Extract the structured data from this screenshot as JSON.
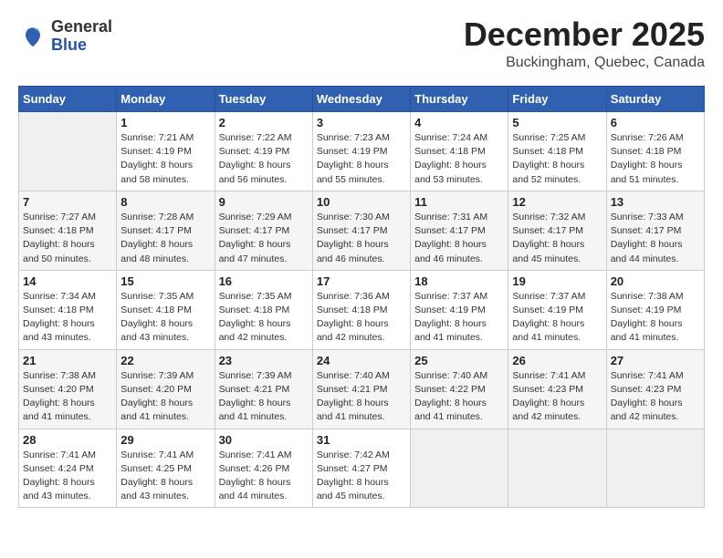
{
  "logo": {
    "general": "General",
    "blue": "Blue"
  },
  "header": {
    "month": "December 2025",
    "location": "Buckingham, Quebec, Canada"
  },
  "days_of_week": [
    "Sunday",
    "Monday",
    "Tuesday",
    "Wednesday",
    "Thursday",
    "Friday",
    "Saturday"
  ],
  "weeks": [
    [
      {
        "day": "",
        "sunrise": "",
        "sunset": "",
        "daylight": ""
      },
      {
        "day": "1",
        "sunrise": "Sunrise: 7:21 AM",
        "sunset": "Sunset: 4:19 PM",
        "daylight": "Daylight: 8 hours and 58 minutes."
      },
      {
        "day": "2",
        "sunrise": "Sunrise: 7:22 AM",
        "sunset": "Sunset: 4:19 PM",
        "daylight": "Daylight: 8 hours and 56 minutes."
      },
      {
        "day": "3",
        "sunrise": "Sunrise: 7:23 AM",
        "sunset": "Sunset: 4:19 PM",
        "daylight": "Daylight: 8 hours and 55 minutes."
      },
      {
        "day": "4",
        "sunrise": "Sunrise: 7:24 AM",
        "sunset": "Sunset: 4:18 PM",
        "daylight": "Daylight: 8 hours and 53 minutes."
      },
      {
        "day": "5",
        "sunrise": "Sunrise: 7:25 AM",
        "sunset": "Sunset: 4:18 PM",
        "daylight": "Daylight: 8 hours and 52 minutes."
      },
      {
        "day": "6",
        "sunrise": "Sunrise: 7:26 AM",
        "sunset": "Sunset: 4:18 PM",
        "daylight": "Daylight: 8 hours and 51 minutes."
      }
    ],
    [
      {
        "day": "7",
        "sunrise": "Sunrise: 7:27 AM",
        "sunset": "Sunset: 4:18 PM",
        "daylight": "Daylight: 8 hours and 50 minutes."
      },
      {
        "day": "8",
        "sunrise": "Sunrise: 7:28 AM",
        "sunset": "Sunset: 4:17 PM",
        "daylight": "Daylight: 8 hours and 48 minutes."
      },
      {
        "day": "9",
        "sunrise": "Sunrise: 7:29 AM",
        "sunset": "Sunset: 4:17 PM",
        "daylight": "Daylight: 8 hours and 47 minutes."
      },
      {
        "day": "10",
        "sunrise": "Sunrise: 7:30 AM",
        "sunset": "Sunset: 4:17 PM",
        "daylight": "Daylight: 8 hours and 46 minutes."
      },
      {
        "day": "11",
        "sunrise": "Sunrise: 7:31 AM",
        "sunset": "Sunset: 4:17 PM",
        "daylight": "Daylight: 8 hours and 46 minutes."
      },
      {
        "day": "12",
        "sunrise": "Sunrise: 7:32 AM",
        "sunset": "Sunset: 4:17 PM",
        "daylight": "Daylight: 8 hours and 45 minutes."
      },
      {
        "day": "13",
        "sunrise": "Sunrise: 7:33 AM",
        "sunset": "Sunset: 4:17 PM",
        "daylight": "Daylight: 8 hours and 44 minutes."
      }
    ],
    [
      {
        "day": "14",
        "sunrise": "Sunrise: 7:34 AM",
        "sunset": "Sunset: 4:18 PM",
        "daylight": "Daylight: 8 hours and 43 minutes."
      },
      {
        "day": "15",
        "sunrise": "Sunrise: 7:35 AM",
        "sunset": "Sunset: 4:18 PM",
        "daylight": "Daylight: 8 hours and 43 minutes."
      },
      {
        "day": "16",
        "sunrise": "Sunrise: 7:35 AM",
        "sunset": "Sunset: 4:18 PM",
        "daylight": "Daylight: 8 hours and 42 minutes."
      },
      {
        "day": "17",
        "sunrise": "Sunrise: 7:36 AM",
        "sunset": "Sunset: 4:18 PM",
        "daylight": "Daylight: 8 hours and 42 minutes."
      },
      {
        "day": "18",
        "sunrise": "Sunrise: 7:37 AM",
        "sunset": "Sunset: 4:19 PM",
        "daylight": "Daylight: 8 hours and 41 minutes."
      },
      {
        "day": "19",
        "sunrise": "Sunrise: 7:37 AM",
        "sunset": "Sunset: 4:19 PM",
        "daylight": "Daylight: 8 hours and 41 minutes."
      },
      {
        "day": "20",
        "sunrise": "Sunrise: 7:38 AM",
        "sunset": "Sunset: 4:19 PM",
        "daylight": "Daylight: 8 hours and 41 minutes."
      }
    ],
    [
      {
        "day": "21",
        "sunrise": "Sunrise: 7:38 AM",
        "sunset": "Sunset: 4:20 PM",
        "daylight": "Daylight: 8 hours and 41 minutes."
      },
      {
        "day": "22",
        "sunrise": "Sunrise: 7:39 AM",
        "sunset": "Sunset: 4:20 PM",
        "daylight": "Daylight: 8 hours and 41 minutes."
      },
      {
        "day": "23",
        "sunrise": "Sunrise: 7:39 AM",
        "sunset": "Sunset: 4:21 PM",
        "daylight": "Daylight: 8 hours and 41 minutes."
      },
      {
        "day": "24",
        "sunrise": "Sunrise: 7:40 AM",
        "sunset": "Sunset: 4:21 PM",
        "daylight": "Daylight: 8 hours and 41 minutes."
      },
      {
        "day": "25",
        "sunrise": "Sunrise: 7:40 AM",
        "sunset": "Sunset: 4:22 PM",
        "daylight": "Daylight: 8 hours and 41 minutes."
      },
      {
        "day": "26",
        "sunrise": "Sunrise: 7:41 AM",
        "sunset": "Sunset: 4:23 PM",
        "daylight": "Daylight: 8 hours and 42 minutes."
      },
      {
        "day": "27",
        "sunrise": "Sunrise: 7:41 AM",
        "sunset": "Sunset: 4:23 PM",
        "daylight": "Daylight: 8 hours and 42 minutes."
      }
    ],
    [
      {
        "day": "28",
        "sunrise": "Sunrise: 7:41 AM",
        "sunset": "Sunset: 4:24 PM",
        "daylight": "Daylight: 8 hours and 43 minutes."
      },
      {
        "day": "29",
        "sunrise": "Sunrise: 7:41 AM",
        "sunset": "Sunset: 4:25 PM",
        "daylight": "Daylight: 8 hours and 43 minutes."
      },
      {
        "day": "30",
        "sunrise": "Sunrise: 7:41 AM",
        "sunset": "Sunset: 4:26 PM",
        "daylight": "Daylight: 8 hours and 44 minutes."
      },
      {
        "day": "31",
        "sunrise": "Sunrise: 7:42 AM",
        "sunset": "Sunset: 4:27 PM",
        "daylight": "Daylight: 8 hours and 45 minutes."
      },
      {
        "day": "",
        "sunrise": "",
        "sunset": "",
        "daylight": ""
      },
      {
        "day": "",
        "sunrise": "",
        "sunset": "",
        "daylight": ""
      },
      {
        "day": "",
        "sunrise": "",
        "sunset": "",
        "daylight": ""
      }
    ]
  ]
}
